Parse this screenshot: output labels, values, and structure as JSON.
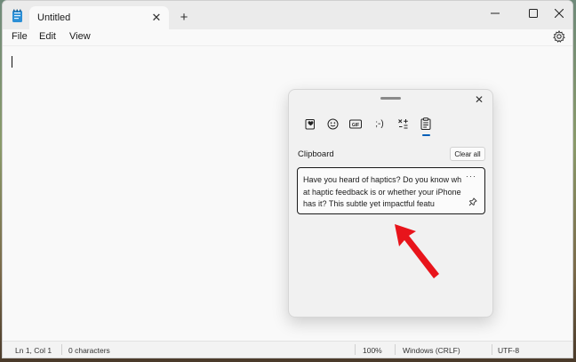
{
  "window": {
    "tab_title": "Untitled",
    "tab_close_glyph": "✕",
    "new_tab_glyph": "+",
    "minimize_glyph": "—",
    "close_glyph": "✕"
  },
  "menu": {
    "file": "File",
    "edit": "Edit",
    "view": "View"
  },
  "status": {
    "position": "Ln 1, Col 1",
    "characters": "0 characters",
    "zoom": "100%",
    "line_ending": "Windows (CRLF)",
    "encoding": "UTF-8"
  },
  "clipboard_panel": {
    "close_glyph": "✕",
    "categories": [
      "favorites-icon",
      "emoji-icon",
      "gif-icon",
      "kaomoji-icon",
      "symbols-icon",
      "clipboard-icon"
    ],
    "kaomoji_label": ";-)",
    "gif_label": "GIF",
    "heading": "Clipboard",
    "clear_all": "Clear all",
    "item": {
      "text": "Have you heard of haptics? Do you know what haptic feedback is or whether your iPhone has it? This subtle yet impactful featu",
      "more_glyph": "···"
    }
  },
  "colors": {
    "accent": "#005fb8",
    "arrow": "#e8141b"
  }
}
